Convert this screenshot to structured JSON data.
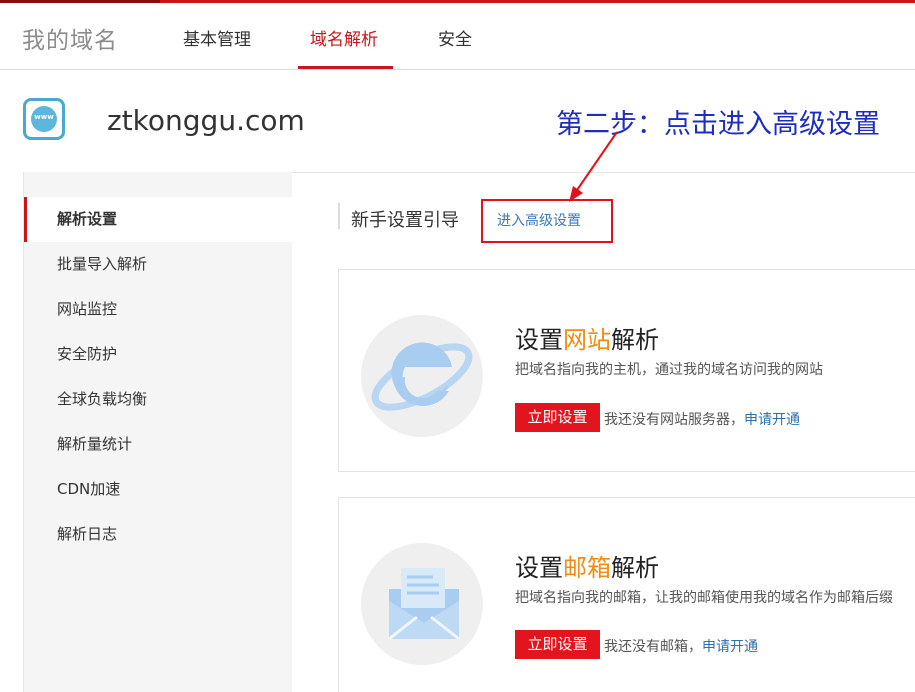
{
  "header": {
    "brand": "我的域名",
    "tabs": [
      {
        "label": "基本管理"
      },
      {
        "label": "域名解析"
      },
      {
        "label": "安全"
      }
    ]
  },
  "domain": {
    "icon": "www-globe-icon",
    "icon_text": "www",
    "name": "ztkonggu.com"
  },
  "annotation": {
    "text": "第二步：点击进入高级设置",
    "color": "#1f2dbf"
  },
  "sidebar": {
    "items": [
      {
        "label": "解析设置"
      },
      {
        "label": "批量导入解析"
      },
      {
        "label": "网站监控"
      },
      {
        "label": "安全防护"
      },
      {
        "label": "全球负载均衡"
      },
      {
        "label": "解析量统计"
      },
      {
        "label": "CDN加速"
      },
      {
        "label": "解析日志"
      }
    ]
  },
  "main": {
    "guide_title": "新手设置引导",
    "advanced_link": "进入高级设置",
    "cards": [
      {
        "icon": "ie-browser-icon",
        "title_prefix": "设置",
        "title_highlight": "网站",
        "title_suffix": "解析",
        "desc": "把域名指向我的主机，通过我的域名访问我的网站",
        "button": "立即设置",
        "note": "我还没有网站服务器，",
        "apply": "申请开通"
      },
      {
        "icon": "mail-envelope-icon",
        "title_prefix": "设置",
        "title_highlight": "邮箱",
        "title_suffix": "解析",
        "desc": "把域名指向我的邮箱，让我的邮箱使用我的域名作为邮箱后缀",
        "button": "立即设置",
        "note": "我还没有邮箱，",
        "apply": "申请开通"
      }
    ]
  },
  "colors": {
    "brand_red": "#c9161d",
    "highlight_orange": "#f08c12",
    "link_blue": "#3d77b5",
    "button_red": "#e2151e"
  }
}
